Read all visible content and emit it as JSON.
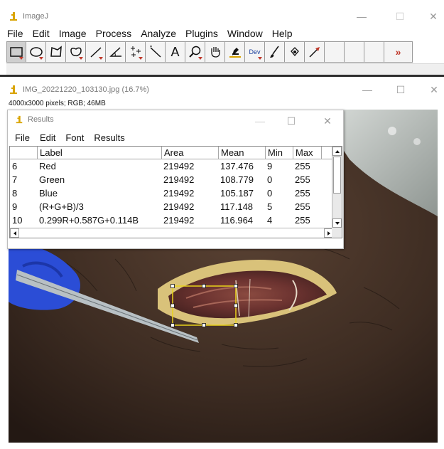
{
  "imagej": {
    "title": "ImageJ",
    "menu": [
      "File",
      "Edit",
      "Image",
      "Process",
      "Analyze",
      "Plugins",
      "Window",
      "Help"
    ],
    "tools": [
      {
        "icon": "rectangle-icon"
      },
      {
        "icon": "oval-icon"
      },
      {
        "icon": "polygon-icon"
      },
      {
        "icon": "freehand-icon"
      },
      {
        "icon": "line-icon"
      },
      {
        "icon": "angle-icon"
      },
      {
        "icon": "multipoint-icon"
      },
      {
        "icon": "wand-icon"
      },
      {
        "icon": "text-tool-icon",
        "label": "A"
      },
      {
        "icon": "magnifier-icon"
      },
      {
        "icon": "hand-icon"
      },
      {
        "icon": "color-picker-icon"
      },
      {
        "icon": "developer-menu-icon",
        "label": "Dev"
      },
      {
        "icon": "brush-icon"
      },
      {
        "icon": "flood-fill-icon"
      },
      {
        "icon": "arrow-icon"
      },
      {
        "icon": "empty-slot"
      },
      {
        "icon": "empty-slot"
      },
      {
        "icon": "empty-slot"
      },
      {
        "icon": "more-tools-icon",
        "label": "»"
      }
    ]
  },
  "image_window": {
    "title": "IMG_20221220_103130.jpg (16.7%)",
    "info": "4000x3000 pixels; RGB; 46MB"
  },
  "results": {
    "title": "Results",
    "menu": [
      "File",
      "Edit",
      "Font",
      "Results"
    ],
    "columns": [
      "",
      "Label",
      "Area",
      "Mean",
      "Min",
      "Max"
    ],
    "rows": [
      [
        "6",
        "Red",
        "219492",
        "137.476",
        "9",
        "255"
      ],
      [
        "7",
        "Green",
        "219492",
        "108.779",
        "0",
        "255"
      ],
      [
        "8",
        "Blue",
        "219492",
        "105.187",
        "0",
        "255"
      ],
      [
        "9",
        "(R+G+B)/3",
        "219492",
        "117.148",
        "5",
        "255"
      ],
      [
        "10",
        "0.299R+0.587G+0.114B",
        "219492",
        "116.964",
        "4",
        "255"
      ]
    ]
  },
  "window_controls": {
    "minimize": "—",
    "maximize": "☐",
    "close": "✕"
  },
  "colors": {
    "accent_red": "#c0392b",
    "selection_yellow": "#e8d21a",
    "icon_yellow": "#d9a400"
  }
}
